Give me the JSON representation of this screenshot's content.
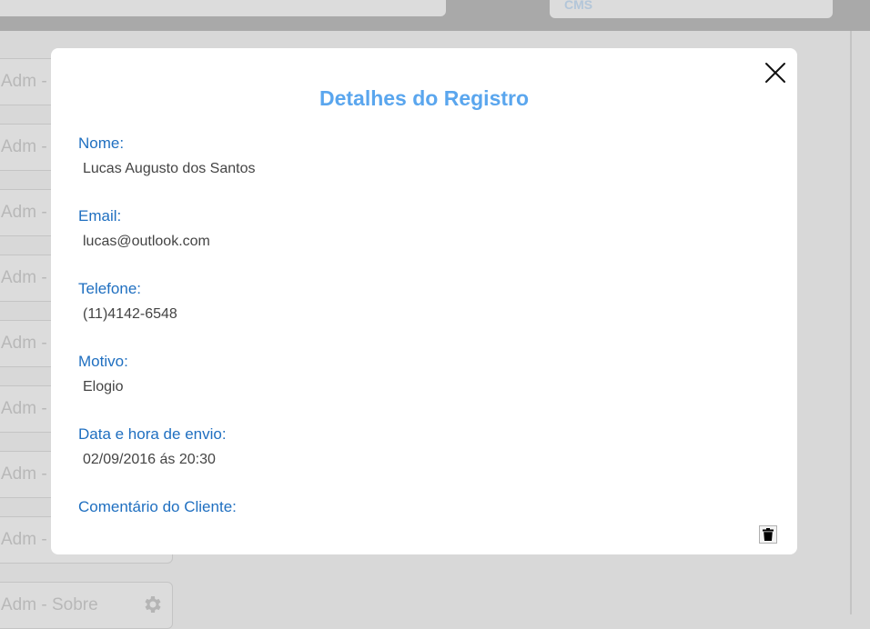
{
  "header": {
    "cms_label": "CMS"
  },
  "background_list": {
    "items": [
      {
        "label": "Adm -"
      },
      {
        "label": "Adm -"
      },
      {
        "label": "Adm -"
      },
      {
        "label": "Adm -"
      },
      {
        "label": "Adm -"
      },
      {
        "label": "Adm -"
      },
      {
        "label": "Adm -"
      },
      {
        "label": "Adm -"
      },
      {
        "label": "Adm - Sobre"
      }
    ]
  },
  "modal": {
    "title": "Detalhes do Registro",
    "fields": [
      {
        "label": "Nome:",
        "value": "Lucas Augusto dos Santos"
      },
      {
        "label": "Email:",
        "value": "lucas@outlook.com"
      },
      {
        "label": "Telefone:",
        "value": "(11)4142-6548"
      },
      {
        "label": "Motivo:",
        "value": "Elogio"
      },
      {
        "label": "Data e hora de envio:",
        "value": "02/09/2016 ás 20:30"
      },
      {
        "label": "Comentário do Cliente:",
        "value": ""
      }
    ]
  },
  "colors": {
    "title": "#5aa6ee",
    "field_label": "#1f6fc0",
    "field_value": "#444444",
    "backdrop": "#d8d8d8"
  },
  "icons": {
    "close": "close-icon",
    "delete": "trash-icon",
    "settings": "gear-icon"
  }
}
